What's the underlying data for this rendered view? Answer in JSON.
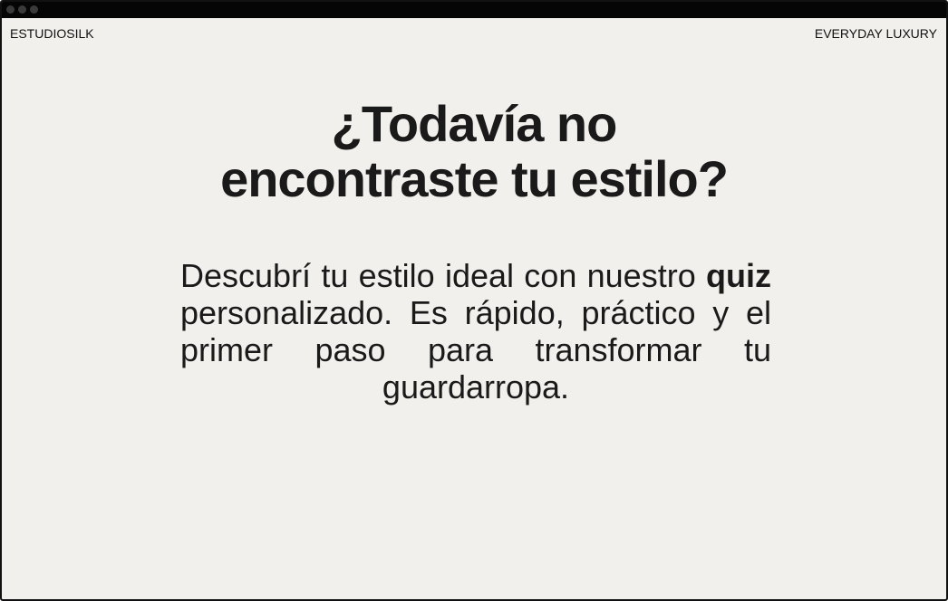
{
  "header": {
    "brand": "ESTUDIOSILK",
    "tagline": "EVERYDAY LUXURY"
  },
  "hero": {
    "title_line_1": "¿Todavía no",
    "title_line_2": "encontraste tu estilo?",
    "description_before": "Descubrí tu estilo ideal con nuestro",
    "description_highlight": "quiz",
    "description_after": "personalizado. Es rápido, práctico y el primer paso para transformar tu guardarropa."
  },
  "colors": {
    "background": "#f1f0ec",
    "text": "#1a1a1a",
    "window_bar": "#050505"
  }
}
